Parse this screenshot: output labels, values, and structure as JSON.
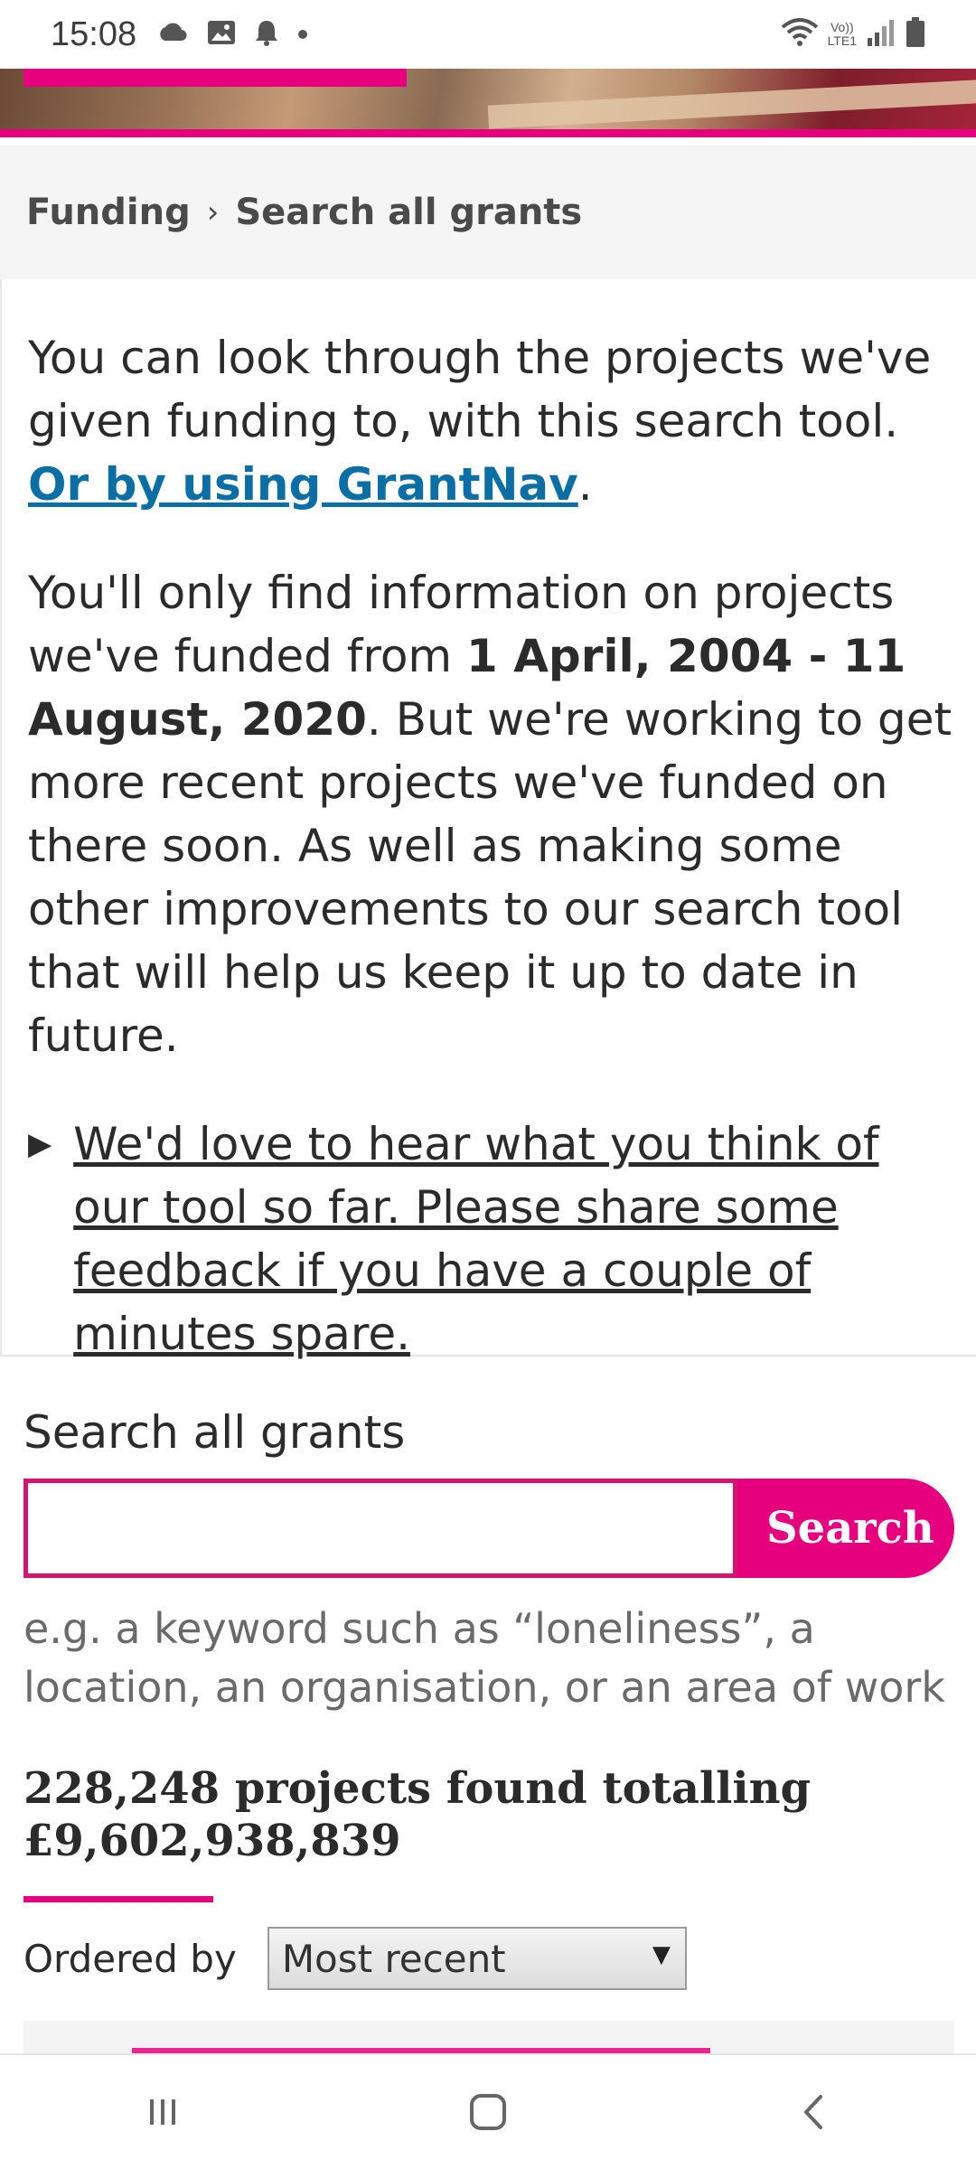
{
  "status_bar": {
    "time": "15:08",
    "left_icons": [
      "cloud-icon",
      "image-icon",
      "bell-icon",
      "dot-icon"
    ],
    "right_icons": [
      "wifi-icon",
      "volte-icon",
      "signal-icon",
      "battery-icon"
    ],
    "volte_line1": "Vo))",
    "volte_line2": "LTE1"
  },
  "breadcrumb": {
    "items": [
      "Funding",
      "Search all grants"
    ],
    "separator": "›"
  },
  "intro": {
    "p1_text": "You can look through the projects we've given funding to, with this search tool. ",
    "p1_link": "Or by using GrantNav",
    "p1_end": ".",
    "p2_a": "You'll only find information on projects we've funded from ",
    "p2_bold": "1 April, 2004 - 11 August, 2020",
    "p2_b": ". But we're working to get more recent projects we've funded on there soon. As well as making some other improvements to our search tool that will help us keep it up to date in future.",
    "feedback_arrow": "▶",
    "feedback_link": "We'd love to hear what you think of our tool so far. Please share some feedback if you have a couple of minutes spare."
  },
  "search": {
    "title": "Search all grants",
    "input_value": "",
    "button_label": "Search",
    "hint": "e.g. a keyword such as “loneliness”, a location, an organisation, or an area of work"
  },
  "results": {
    "summary_line1": "228,248 projects found totalling",
    "summary_line2": "£9,602,938,839"
  },
  "order": {
    "label": "Ordered by",
    "selected": "Most recent",
    "caret": "▼"
  },
  "colors": {
    "brand_pink": "#e6007e",
    "link_blue": "#0b6fa6"
  },
  "nav_bar": {
    "buttons": [
      "recents-icon",
      "home-icon",
      "back-icon"
    ]
  }
}
